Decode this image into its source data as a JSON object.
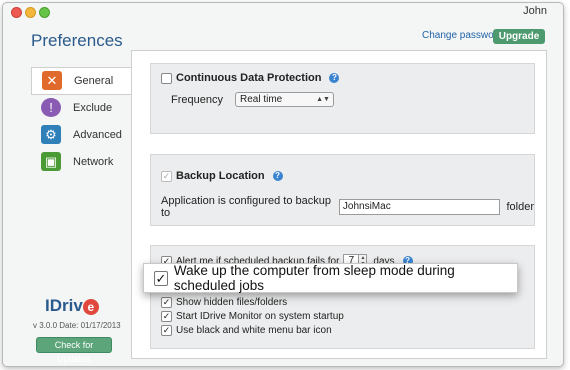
{
  "window": {
    "user": "John"
  },
  "header": {
    "title": "Preferences",
    "change_password": "Change password",
    "upgrade": "Upgrade"
  },
  "sidebar": {
    "items": [
      {
        "label": "General",
        "icon": "tools-icon",
        "active": true
      },
      {
        "label": "Exclude",
        "icon": "exclude-icon",
        "active": false
      },
      {
        "label": "Advanced",
        "icon": "advanced-icon",
        "active": false
      },
      {
        "label": "Network",
        "icon": "network-icon",
        "active": false
      }
    ],
    "logo_text": "IDriv",
    "logo_e": "e",
    "version": "v 3.0.0  Date: 01/17/2013",
    "check_updates": "Check for Updates"
  },
  "cdp": {
    "label": "Continuous Data Protection",
    "checked": false,
    "frequency_label": "Frequency",
    "frequency_value": "Real time"
  },
  "backup_location": {
    "label": "Backup Location",
    "checked": true,
    "description": "Application is configured to backup to",
    "value": "JohnsiMac",
    "suffix": "folder"
  },
  "options": {
    "alert_prefix": "Alert me if scheduled backup fails for",
    "alert_days_value": "7",
    "alert_suffix": "days",
    "wake_label": "Wake up the computer from sleep mode during scheduled jobs",
    "hidden_files": "Show hidden files/folders",
    "start_monitor": "Start IDrive Monitor on system startup",
    "menu_icon": "Use black and white menu bar icon"
  },
  "colors": {
    "accent": "#2a5b8c",
    "upgrade": "#4d9a6e",
    "logo_red": "#e0483d"
  }
}
